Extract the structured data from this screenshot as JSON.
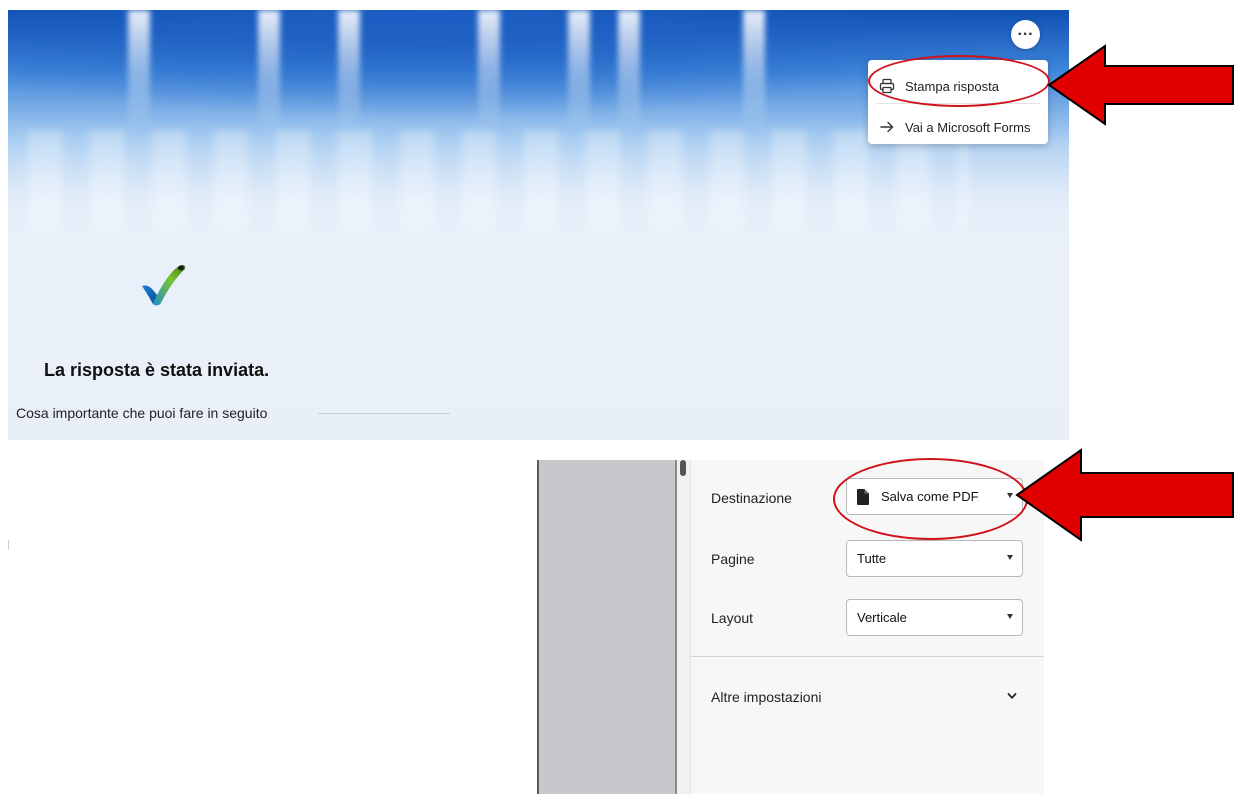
{
  "forms": {
    "more_button": "···",
    "menu": {
      "print_label": "Stampa risposta",
      "goto_label": "Vai a Microsoft Forms"
    },
    "response_title": "La risposta è stata inviata.",
    "next_steps_label": "Cosa importante che puoi fare in seguito"
  },
  "print_dialog": {
    "destination_label": "Destinazione",
    "destination_value": "Salva come PDF",
    "pages_label": "Pagine",
    "pages_value": "Tutte",
    "layout_label": "Layout",
    "layout_value": "Verticale",
    "more_settings_label": "Altre impostazioni"
  },
  "icons": {
    "menu_print": "printer-icon",
    "menu_goto": "arrow-right-icon",
    "destination": "file-icon",
    "more_settings": "chevron-down-icon",
    "response": "checkmark-icon"
  },
  "colors": {
    "annotation_red": "#e00000",
    "header_blue": "#0f4eb3"
  }
}
